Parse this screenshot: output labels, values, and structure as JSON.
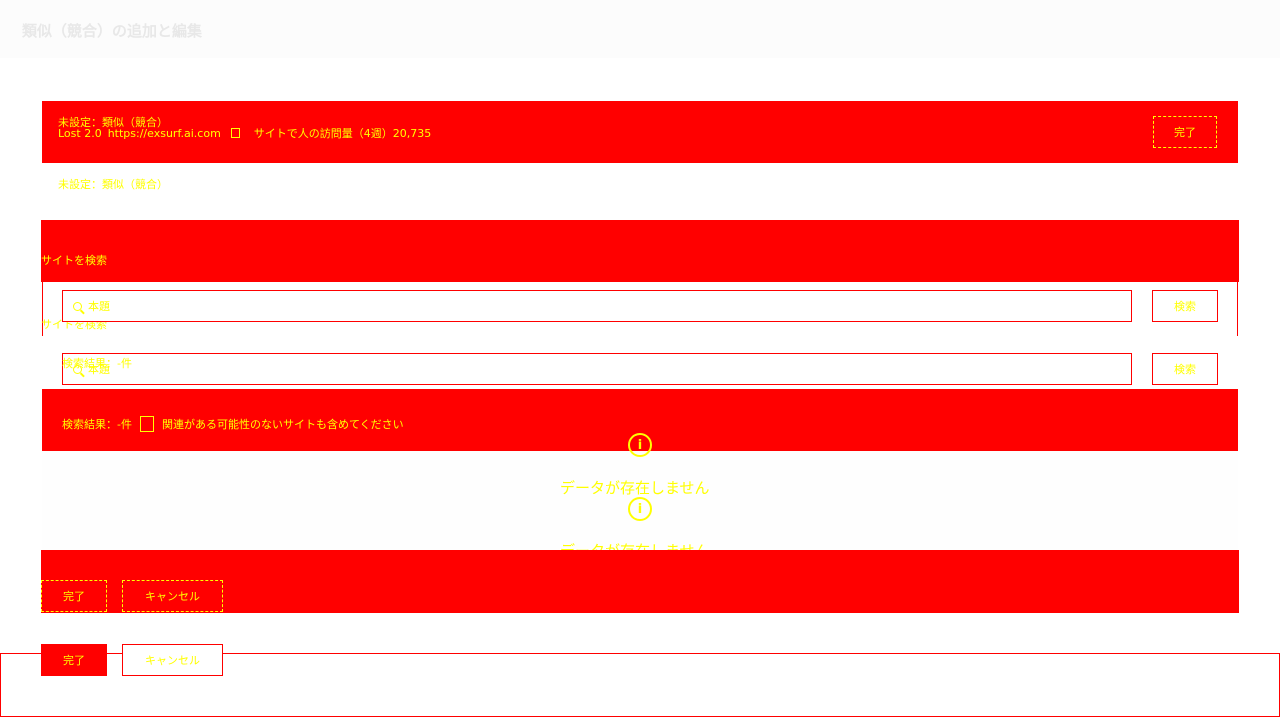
{
  "header": {
    "title": "類似（競合）の追加と編集"
  },
  "info": {
    "line1": "未設定：類似（競合）",
    "url_label": "Lost 2.0",
    "url": "https://exsurf.ai.com",
    "visits": "サイトで人の訪問量（4週）20,735",
    "done_label": "完了"
  },
  "unset": {
    "label": "未設定：類似（競合）"
  },
  "search": {
    "title": "サイトを検索",
    "placeholder": "本題",
    "button_label": "検索"
  },
  "results": {
    "count_label": "検索結果：-件",
    "checkbox_label": "関連がある可能性のないサイトも含めてください",
    "empty_text": "データが存在しません"
  },
  "footer": {
    "done_label": "完了",
    "cancel_label": "キャンセル"
  },
  "icons": {
    "search": "search-icon",
    "info": "info-icon",
    "copy": "copy-icon"
  },
  "colors": {
    "accent": "#ff0000",
    "text": "#ffff00"
  }
}
